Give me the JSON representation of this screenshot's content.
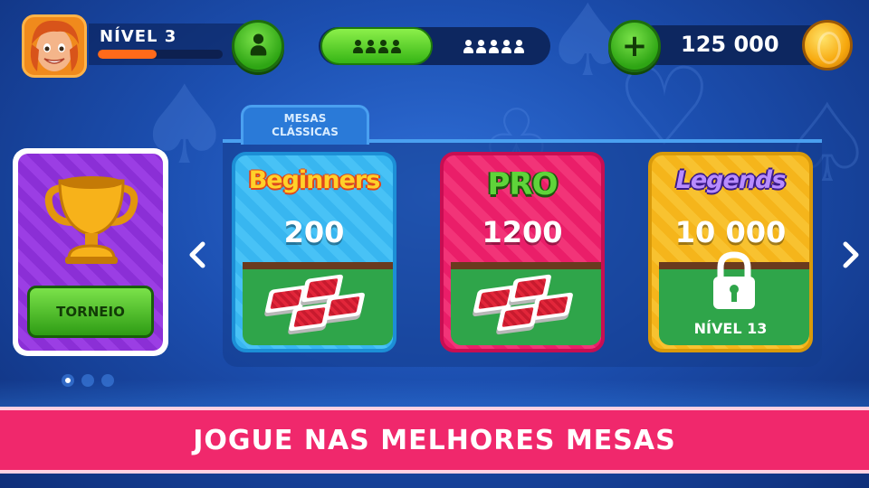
{
  "header": {
    "level_label": "NÍVEL 3",
    "level_progress": 0.47,
    "coins": "125 000"
  },
  "mode_toggle": {
    "options": [
      "4 players",
      "5 players"
    ],
    "selected": "4 players"
  },
  "tournament": {
    "button_label": "TORNEIO"
  },
  "section_tab": {
    "line1": "MESAS",
    "line2": "CLÁSSICAS"
  },
  "tables": [
    {
      "name": "Beginners",
      "price": "200",
      "accent": "#38b6f0",
      "locked": false
    },
    {
      "name": "PRO",
      "price": "1200",
      "accent": "#ea1e69",
      "locked": false
    },
    {
      "name": "Legends",
      "price": "10 000",
      "accent": "#f5b51b",
      "locked": true,
      "lock_label": "NÍVEL 13"
    }
  ],
  "pager": {
    "pages": 3,
    "current": 1
  },
  "banner": {
    "text": "JOGUE NAS MELHORES MESAS"
  },
  "colors": {
    "banner": "#f0286c",
    "green_button": "#3fbf1c",
    "background": "#1c4fb0"
  }
}
